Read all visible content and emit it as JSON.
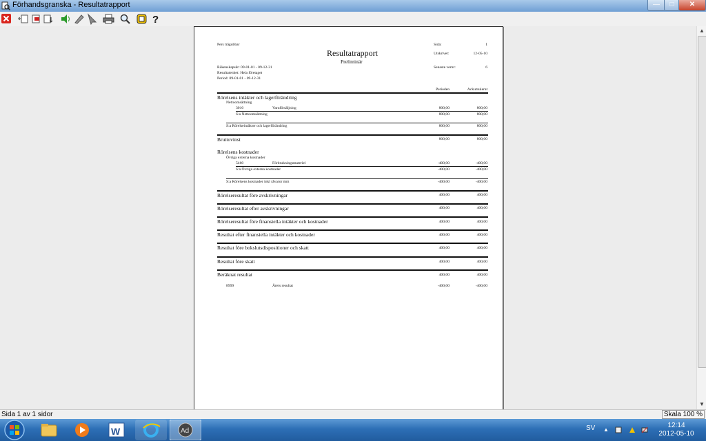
{
  "window": {
    "title": "Förhandsgranska - Resultatrapport"
  },
  "toolbar": {
    "buttons": [
      "close-icon",
      "first-page-icon",
      "delete-page-icon",
      "export-icon",
      "speaker-icon",
      "pen-icon",
      "pointer-icon",
      "print-icon",
      "zoom-icon",
      "warning-icon",
      "help-icon"
    ]
  },
  "report": {
    "company": "Pers trägubbar",
    "title": "Resultatrapport",
    "subtitle": "Preliminär",
    "sida_label": "Sida:",
    "sida_value": "1",
    "utskrivet_label": "Utskrivet:",
    "utskrivet_value": "12-05-10",
    "verno_label": "Senaste vernr:",
    "verno_value": "6",
    "rakenskapsar": "Räkenskapsår: 09-01-01 - 09-12-31",
    "resultatenhet": "Resultatenhet: Hela företaget",
    "period": "Period: 09-01-01 - 09-12-31",
    "col_period": "Perioden",
    "col_ack": "Ackumulerat",
    "sec1_title": "Rörelsens intäkter och lagerförändring",
    "sec1_group": "Nettoomsättning",
    "sec1_acc": "3010",
    "sec1_accname": "Varuförsäljning",
    "sec1_acc_p": "800,00",
    "sec1_acc_a": "800,00",
    "sec1_sum_group": "S:a Nettoomsättning",
    "sec1_sum_group_p": "800,00",
    "sec1_sum_group_a": "800,00",
    "sec1_sum": "S:a Rörelseintäkter och lagerförändring",
    "sec1_sum_p": "800,00",
    "sec1_sum_a": "800,00",
    "brutto": "Bruttovinst",
    "brutto_p": "800,00",
    "brutto_a": "800,00",
    "sec2_title": "Rörelsens kostnader",
    "sec2_group": "Övriga externa kostnader",
    "sec2_acc": "5460",
    "sec2_accname": "Förbrukningsmateriel",
    "sec2_acc_p": "-400,00",
    "sec2_acc_a": "-400,00",
    "sec2_sum_group": "S:a Övriga externa kostnader",
    "sec2_sum_group_p": "-400,00",
    "sec2_sum_group_a": "-400,00",
    "sec2_sum": "S:a Rörelsens kostnader inkl råvaror mm",
    "sec2_sum_p": "-400,00",
    "sec2_sum_a": "-400,00",
    "totals": [
      {
        "label": "Rörelseresultat före avskrivningar",
        "p": "400,00",
        "a": "400,00"
      },
      {
        "label": "Rörelseresultat efter avskrivningar",
        "p": "400,00",
        "a": "400,00"
      },
      {
        "label": "Rörelseresultat före finansiella intäkter och kostnader",
        "p": "400,00",
        "a": "400,00"
      },
      {
        "label": "Resultat efter finansiella intäkter och kostnader",
        "p": "400,00",
        "a": "400,00"
      },
      {
        "label": "Resultat före bokslutsdispositioner och skatt",
        "p": "400,00",
        "a": "400,00"
      },
      {
        "label": "Resultat före skatt",
        "p": "400,00",
        "a": "400,00"
      },
      {
        "label": "Beräknat resultat",
        "p": "400,00",
        "a": "400,00"
      }
    ],
    "last_acc": "8999",
    "last_accname": "Årets resultat",
    "last_p": "-400,00",
    "last_a": "-400,00"
  },
  "status": {
    "left": "Sida 1 av 1 sidor",
    "right": "Skala 100 %"
  },
  "taskbar": {
    "lang": "SV",
    "time": "12:14",
    "date": "2012-05-10"
  }
}
